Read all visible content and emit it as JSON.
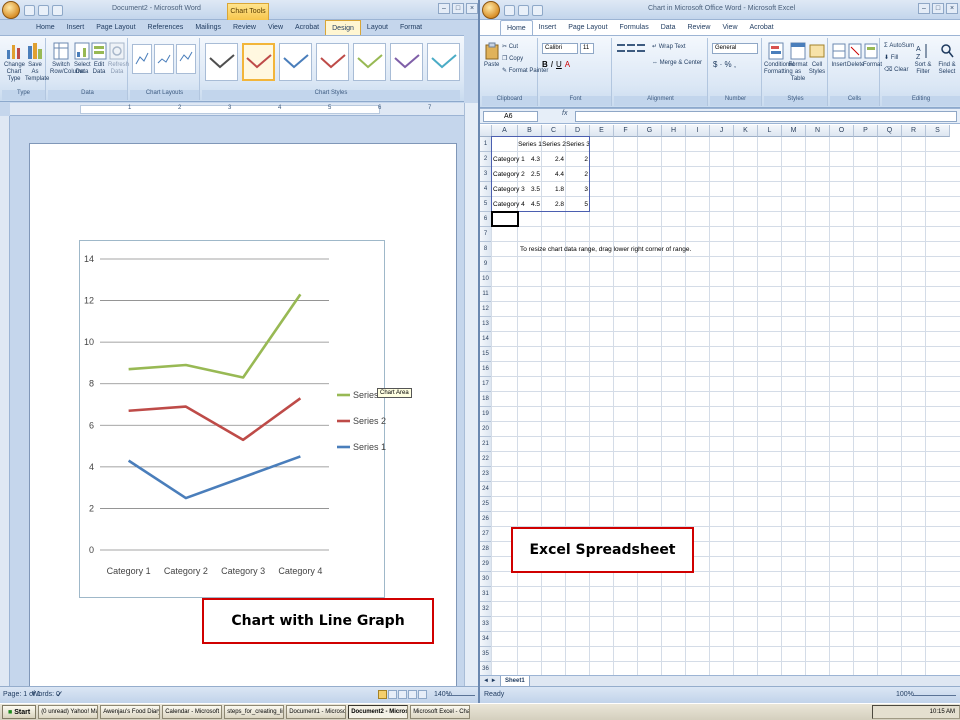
{
  "word": {
    "title": "Document2 - Microsoft Word",
    "context_tab_group": "Chart Tools",
    "tabs": [
      "Home",
      "Insert",
      "Page Layout",
      "References",
      "Mailings",
      "Review",
      "View",
      "Acrobat",
      "Design",
      "Layout",
      "Format"
    ],
    "active_tab": "Design",
    "ribbon": {
      "type_group": "Type",
      "change_chart_type": "Change Chart Type",
      "save_as_template": "Save As Template",
      "data_group": "Data",
      "switch_row_column": "Switch Row/Column",
      "select_data": "Select Data",
      "edit_data": "Edit Data",
      "refresh_data": "Refresh Data",
      "chart_layouts_group": "Chart Layouts",
      "chart_styles_group": "Chart Styles"
    },
    "ruler_marks": [
      "1",
      "2",
      "3",
      "4",
      "5",
      "6",
      "7"
    ],
    "status": {
      "page": "Page: 1 of 1",
      "words": "Words: 0",
      "zoom": "140%"
    },
    "chart_tooltip": "Chart Area",
    "callout": "Chart with Line Graph"
  },
  "chart_data": {
    "type": "line",
    "categories": [
      "Category 1",
      "Category 2",
      "Category 3",
      "Category 4"
    ],
    "series": [
      {
        "name": "Series 1",
        "values": [
          4.3,
          2.5,
          3.5,
          4.5
        ],
        "color": "#4a7ebb"
      },
      {
        "name": "Series 2",
        "values": [
          6.7,
          6.9,
          5.3,
          7.3
        ],
        "color": "#be4b48"
      },
      {
        "name": "Series 3",
        "values": [
          8.7,
          8.9,
          8.3,
          12.3
        ],
        "color": "#98b954"
      }
    ],
    "ylim": [
      0,
      14
    ],
    "yticks": [
      "0",
      "2",
      "4",
      "6",
      "8",
      "10",
      "12",
      "14"
    ],
    "grid": true,
    "legend_position": "right"
  },
  "excel": {
    "title": "Chart in Microsoft Office Word - Microsoft Excel",
    "tabs": [
      "Home",
      "Insert",
      "Page Layout",
      "Formulas",
      "Data",
      "Review",
      "View",
      "Acrobat"
    ],
    "active_tab": "Home",
    "ribbon": {
      "cut": "Cut",
      "copy": "Copy",
      "format_painter": "Format Painter",
      "paste": "Paste",
      "clipboard": "Clipboard",
      "font_name": "Calibri",
      "font_size": "11",
      "font": "Font",
      "wrap_text": "Wrap Text",
      "merge_center": "Merge & Center",
      "alignment": "Alignment",
      "number_format": "General",
      "number": "Number",
      "conditional_formatting": "Conditional Formatting",
      "format_as_table": "Format as Table",
      "cell_styles": "Cell Styles",
      "styles": "Styles",
      "insert": "Insert",
      "delete": "Delete",
      "format": "Format",
      "cells": "Cells",
      "autosum": "AutoSum",
      "fill": "Fill",
      "clear": "Clear",
      "sort_filter": "Sort & Filter",
      "find_select": "Find & Select",
      "editing": "Editing"
    },
    "name_box": "A6",
    "fx": "fx",
    "columns": [
      "A",
      "B",
      "C",
      "D",
      "E",
      "F",
      "G",
      "H",
      "I",
      "J",
      "K",
      "L",
      "M",
      "N",
      "O",
      "P",
      "Q",
      "R",
      "S"
    ],
    "table": {
      "headers": [
        "",
        "Series 1",
        "Series 2",
        "Series 3"
      ],
      "rows": [
        [
          "Category 1",
          "4.3",
          "2.4",
          "2"
        ],
        [
          "Category 2",
          "2.5",
          "4.4",
          "2"
        ],
        [
          "Category 3",
          "3.5",
          "1.8",
          "3"
        ],
        [
          "Category 4",
          "4.5",
          "2.8",
          "5"
        ]
      ]
    },
    "note": "To resize chart data range, drag lower right corner of range.",
    "sheet_tab": "Sheet1",
    "status": {
      "ready": "Ready",
      "zoom": "100%"
    },
    "callout": "Excel Spreadsheet"
  },
  "taskbar": {
    "start": "Start",
    "buttons": [
      "(0 unread) Yahoo! Mail...",
      "Awenjau's Food Diary |...",
      "Calendar - Microsoft O...",
      "steps_for_creating_lin...",
      "Document1 - Microsoft ...",
      "Document2 - Micros...",
      "Microsoft Excel - Chart ..."
    ],
    "active_index": 5,
    "time": "10:15 AM"
  }
}
